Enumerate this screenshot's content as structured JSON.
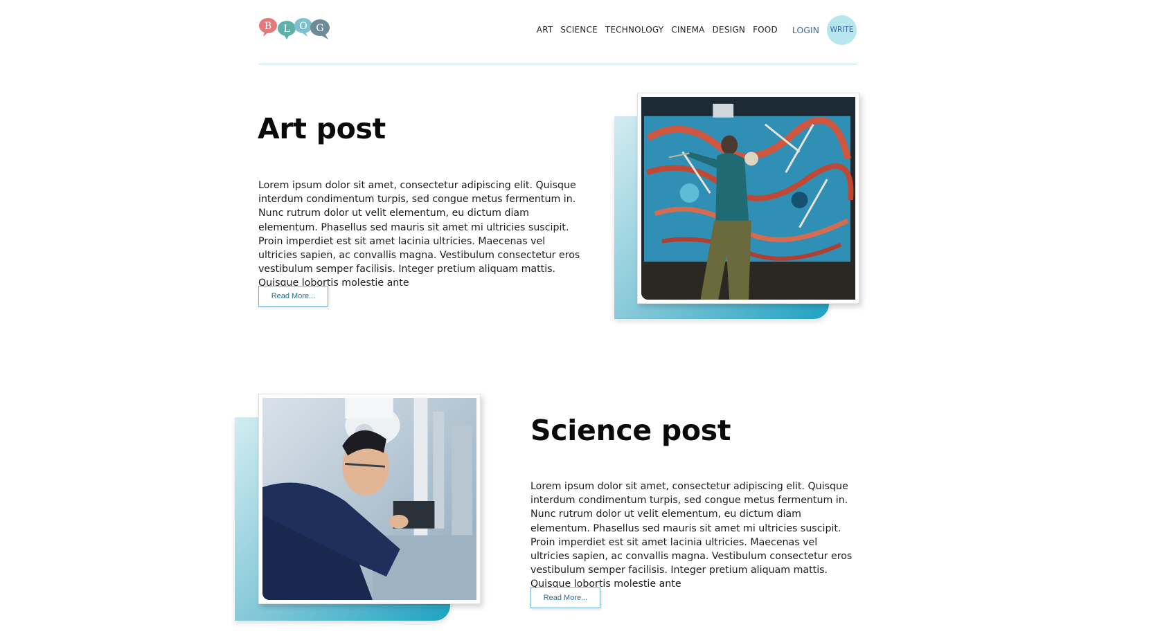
{
  "header": {
    "logo": {
      "letters": [
        "B",
        "L",
        "O",
        "G"
      ],
      "colors": [
        "#e27a7a",
        "#5fb0a8",
        "#7fc0cf",
        "#6e8a96"
      ]
    },
    "nav": [
      "ART",
      "SCIENCE",
      "TECHNOLOGY",
      "CINEMA",
      "DESIGN",
      "FOOD"
    ],
    "login_label": "LOGIN",
    "write_label": "WRITE"
  },
  "posts": [
    {
      "title": "Art post",
      "body": "Lorem ipsum dolor sit amet, consectetur adipiscing elit. Quisque interdum condimentum turpis, sed congue metus fermentum in. Nunc rutrum dolor ut velit elementum, eu dictum diam elementum. Phasellus sed mauris sit amet mi ultricies suscipit. Proin imperdiet est sit amet lacinia ultricies. Maecenas vel ultricies sapien, ac convallis magna. Vestibulum consectetur eros vestibulum semper facilisis. Integer pretium aliquam mattis. Quisque lobortis molestie ante",
      "read_more": "Read More..."
    },
    {
      "title": "Science post",
      "body": "Lorem ipsum dolor sit amet, consectetur adipiscing elit. Quisque interdum condimentum turpis, sed congue metus fermentum in. Nunc rutrum dolor ut velit elementum, eu dictum diam elementum. Phasellus sed mauris sit amet mi ultricies suscipit. Proin imperdiet est sit amet lacinia ultricies. Maecenas vel ultricies sapien, ac convallis magna. Vestibulum consectetur eros vestibulum semper facilisis. Integer pretium aliquam mattis. Quisque lobortis molestie ante",
      "read_more": "Read More..."
    }
  ],
  "colors": {
    "accent": "#1da3c3",
    "divider": "#a9dbe6",
    "link": "#3a6aa8",
    "write_bg": "#b8e6ef"
  }
}
